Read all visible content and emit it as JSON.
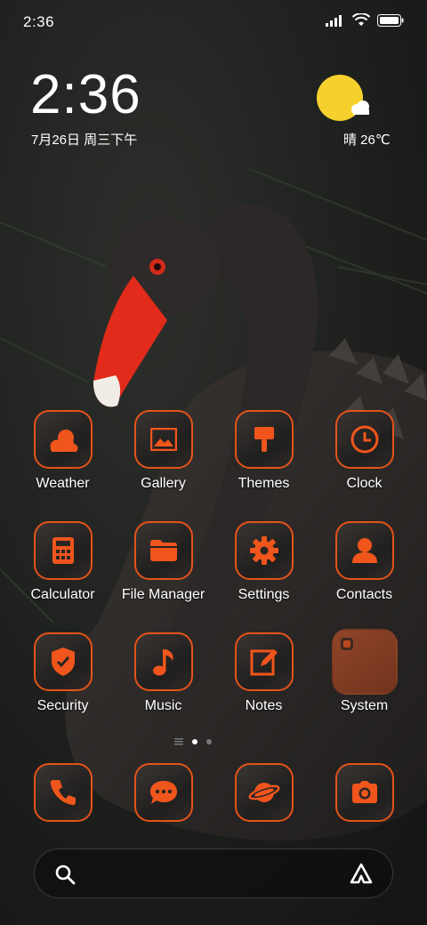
{
  "status": {
    "time": "2:36"
  },
  "lock": {
    "time": "2:36",
    "date": "7月26日 周三下午"
  },
  "weather": {
    "text": "晴 26℃"
  },
  "apps": [
    {
      "label": "Weather",
      "icon": "weather-icon"
    },
    {
      "label": "Gallery",
      "icon": "gallery-icon"
    },
    {
      "label": "Themes",
      "icon": "brush-icon"
    },
    {
      "label": "Clock",
      "icon": "clock-icon"
    },
    {
      "label": "Calculator",
      "icon": "calculator-icon"
    },
    {
      "label": "File Manager",
      "icon": "folder-icon"
    },
    {
      "label": "Settings",
      "icon": "gear-icon"
    },
    {
      "label": "Contacts",
      "icon": "person-icon"
    },
    {
      "label": "Security",
      "icon": "shield-icon"
    },
    {
      "label": "Music",
      "icon": "music-note-icon"
    },
    {
      "label": "Notes",
      "icon": "notes-icon"
    },
    {
      "label": "System",
      "icon": "folder-thumb-icon"
    }
  ],
  "dock": [
    {
      "icon": "phone-icon"
    },
    {
      "icon": "message-icon"
    },
    {
      "icon": "browser-planet-icon"
    },
    {
      "icon": "camera-icon"
    }
  ],
  "colors": {
    "accent": "#e4531a",
    "sun": "#f6d12d"
  }
}
